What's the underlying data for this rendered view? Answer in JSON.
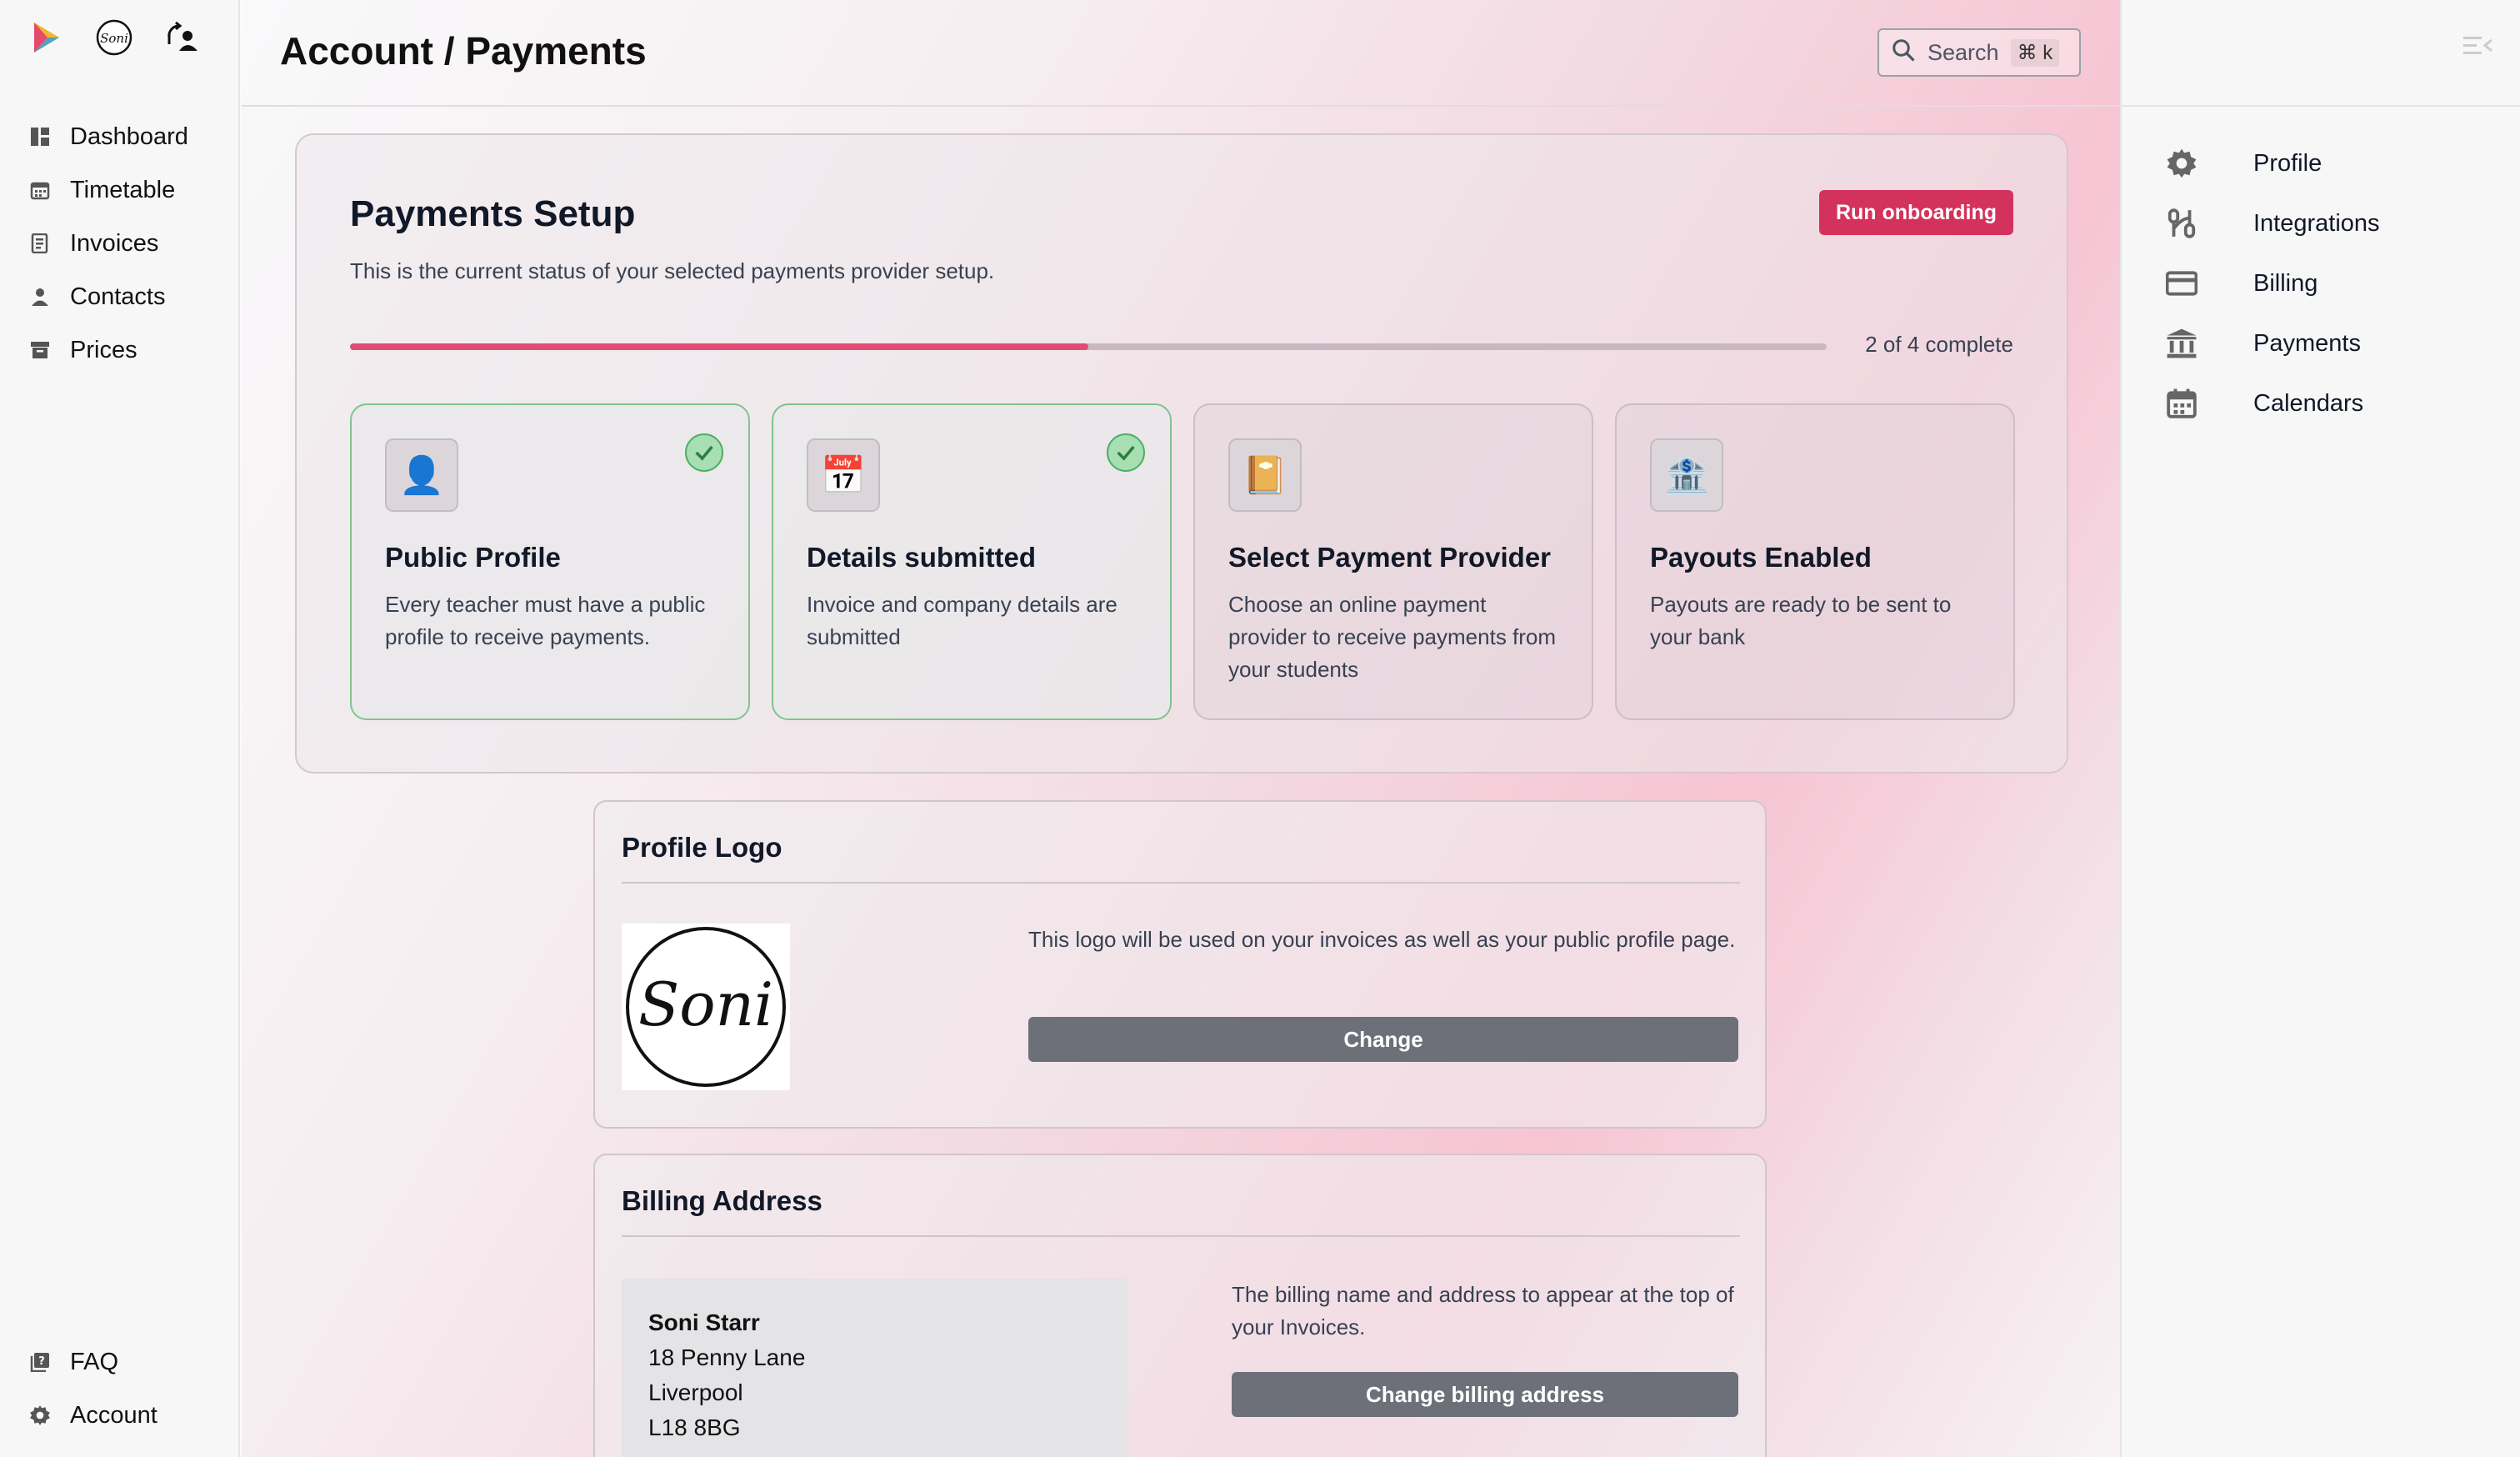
{
  "sidebar": {
    "nav": [
      {
        "label": "Dashboard",
        "icon": "dashboard-icon"
      },
      {
        "label": "Timetable",
        "icon": "calendar-icon"
      },
      {
        "label": "Invoices",
        "icon": "invoice-icon"
      },
      {
        "label": "Contacts",
        "icon": "person-icon"
      },
      {
        "label": "Prices",
        "icon": "archive-icon"
      }
    ],
    "bottom": [
      {
        "label": "FAQ",
        "icon": "faq-icon"
      },
      {
        "label": "Account",
        "icon": "gear-icon"
      }
    ],
    "brand_logo_text": "Soni"
  },
  "header": {
    "title": "Account / Payments",
    "search_label": "Search",
    "search_shortcut": "⌘ k"
  },
  "setup": {
    "title": "Payments Setup",
    "description": "This is the current status of your selected payments provider setup.",
    "run_button": "Run onboarding",
    "progress": {
      "completed": 2,
      "total": 4,
      "text": "2 of 4 complete"
    },
    "steps": [
      {
        "title": "Public Profile",
        "description": "Every teacher must have a public profile to receive payments.",
        "done": true,
        "icon": "👤"
      },
      {
        "title": "Details submitted",
        "description": "Invoice and company details are submitted",
        "done": true,
        "icon": "📅"
      },
      {
        "title": "Select Payment Provider",
        "description": "Choose an online payment provider to receive payments from your students",
        "done": false,
        "icon": "📔"
      },
      {
        "title": "Payouts Enabled",
        "description": "Payouts are ready to be sent to your bank",
        "done": false,
        "icon": "🏦"
      }
    ]
  },
  "profile_logo": {
    "title": "Profile Logo",
    "logo_text": "Soni",
    "description": "This logo will be used on your invoices as well as your public profile page.",
    "button": "Change"
  },
  "billing": {
    "title": "Billing Address",
    "name": "Soni Starr",
    "line1": "18 Penny Lane",
    "line2": "Liverpool",
    "line3": "L18 8BG",
    "description": "The billing name and address to appear at the top of your Invoices.",
    "button": "Change billing address"
  },
  "settings": {
    "items": [
      {
        "label": "Profile",
        "icon": "gear-icon"
      },
      {
        "label": "Integrations",
        "icon": "integrations-icon"
      },
      {
        "label": "Billing",
        "icon": "credit-card-icon"
      },
      {
        "label": "Payments",
        "icon": "bank-icon"
      },
      {
        "label": "Calendars",
        "icon": "calendar-icon"
      }
    ]
  },
  "colors": {
    "accent": "#d3325c",
    "progress": "#e24c74",
    "success": "#4caf65"
  }
}
